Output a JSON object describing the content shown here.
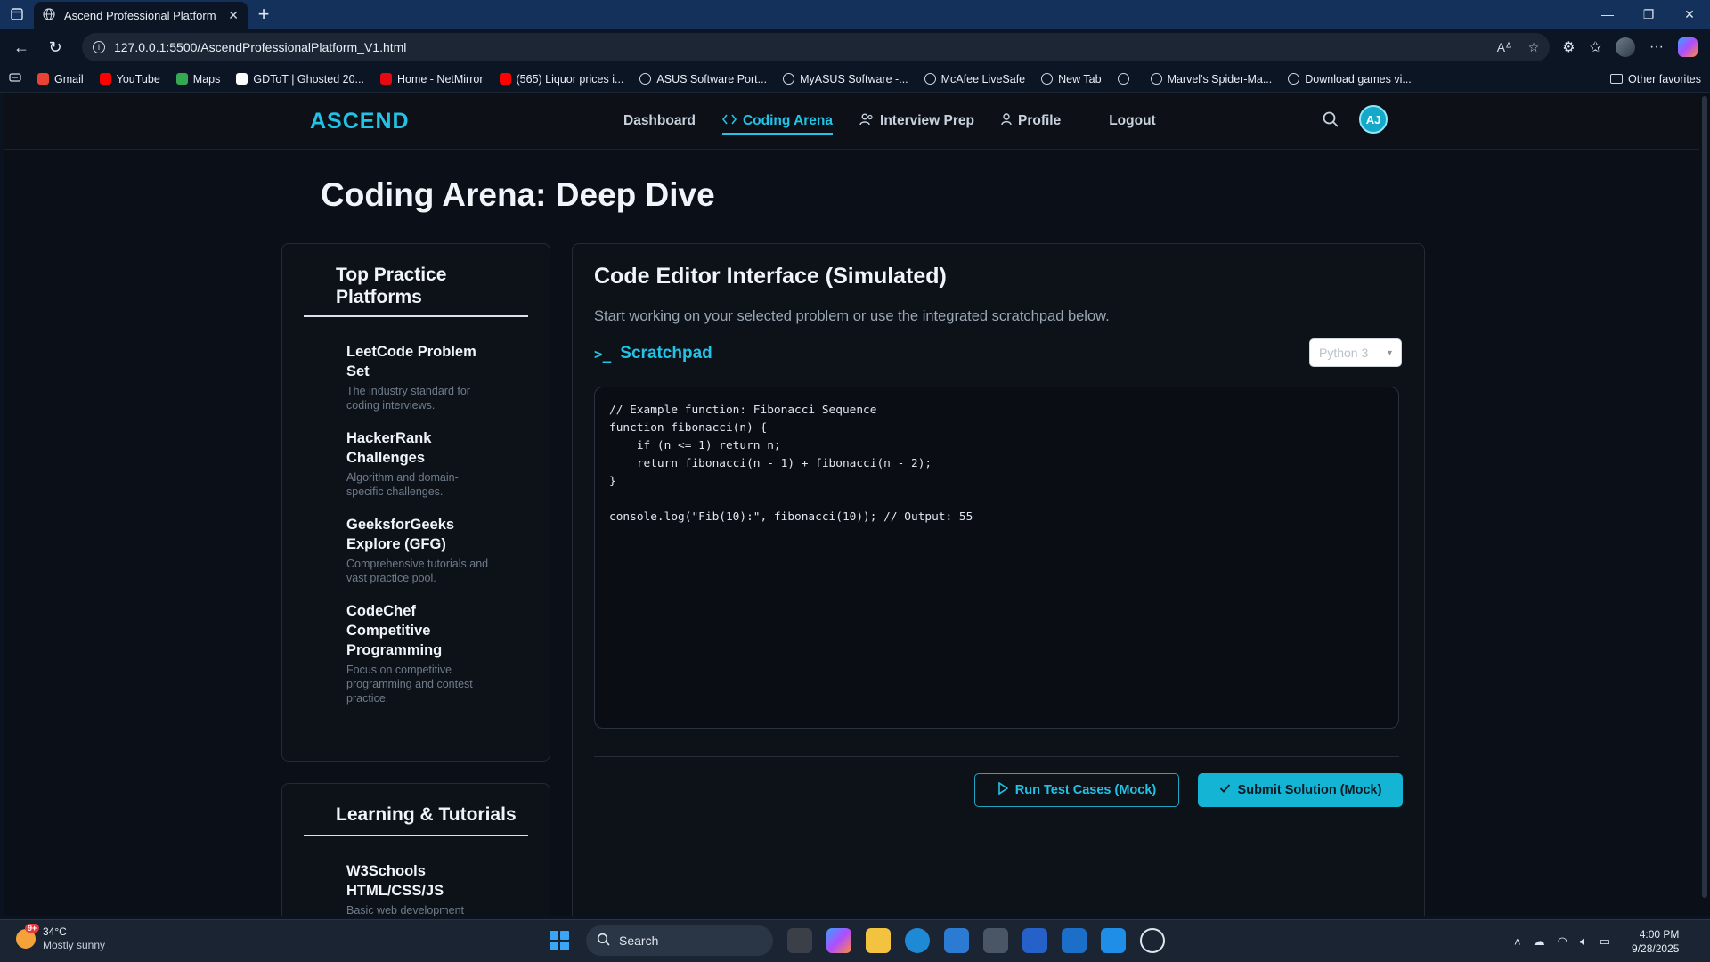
{
  "browser": {
    "tab_title": "Ascend Professional Platform - Co",
    "url": "127.0.0.1:5500/AscendProfessionalPlatform_V1.html",
    "bookmarks": [
      {
        "label": "Gmail",
        "color": "#ea4335"
      },
      {
        "label": "YouTube",
        "color": "#ff0000"
      },
      {
        "label": "Maps",
        "color": "#34a853"
      },
      {
        "label": "GDToT | Ghosted 20...",
        "color": "#ffffff"
      },
      {
        "label": "Home - NetMirror",
        "color": "#e50914"
      },
      {
        "label": "(565) Liquor prices i...",
        "color": "#ff0000"
      },
      {
        "label": "ASUS Software Port...",
        "color": ""
      },
      {
        "label": "MyASUS Software -...",
        "color": ""
      },
      {
        "label": "McAfee LiveSafe",
        "color": ""
      },
      {
        "label": "New Tab",
        "color": ""
      },
      {
        "label": "",
        "color": ""
      },
      {
        "label": "Marvel's Spider-Ma...",
        "color": ""
      },
      {
        "label": "Download games vi...",
        "color": ""
      }
    ],
    "other_favorites": "Other favorites"
  },
  "app": {
    "logo": "ASCEND",
    "nav": {
      "dashboard": "Dashboard",
      "coding_arena": "Coding Arena",
      "interview_prep": "Interview Prep",
      "profile": "Profile",
      "logout": "Logout"
    },
    "user_initials": "AJ",
    "accent_color": "#22c3e6"
  },
  "page": {
    "title": "Coding Arena: Deep Dive",
    "practice": {
      "heading": "Top Practice Platforms",
      "items": [
        {
          "name": "LeetCode Problem Set",
          "desc": "The industry standard for coding interviews."
        },
        {
          "name": "HackerRank Challenges",
          "desc": "Algorithm and domain-specific challenges."
        },
        {
          "name": "GeeksforGeeks Explore (GFG)",
          "desc": "Comprehensive tutorials and vast practice pool."
        },
        {
          "name": "CodeChef Competitive Programming",
          "desc": "Focus on competitive programming and contest practice."
        }
      ]
    },
    "learning": {
      "heading": "Learning & Tutorials",
      "items": [
        {
          "name": "W3Schools HTML/CSS/JS",
          "desc": "Basic web development"
        }
      ]
    },
    "editor": {
      "title": "Code Editor Interface (Simulated)",
      "subtitle": "Start working on your selected problem or use the integrated scratchpad below.",
      "scratchpad_label": "Scratchpad",
      "language": "Python 3",
      "code": "// Example function: Fibonacci Sequence\nfunction fibonacci(n) {\n    if (n <= 1) return n;\n    return fibonacci(n - 1) + fibonacci(n - 2);\n}\n\nconsole.log(\"Fib(10):\", fibonacci(10)); // Output: 55",
      "run_label": "Run Test Cases (Mock)",
      "submit_label": "Submit Solution (Mock)"
    }
  },
  "taskbar": {
    "temperature": "34°C",
    "weather": "Mostly sunny",
    "weather_badge": "9+",
    "search_placeholder": "Search",
    "time": "4:00 PM",
    "date": "9/28/2025"
  }
}
